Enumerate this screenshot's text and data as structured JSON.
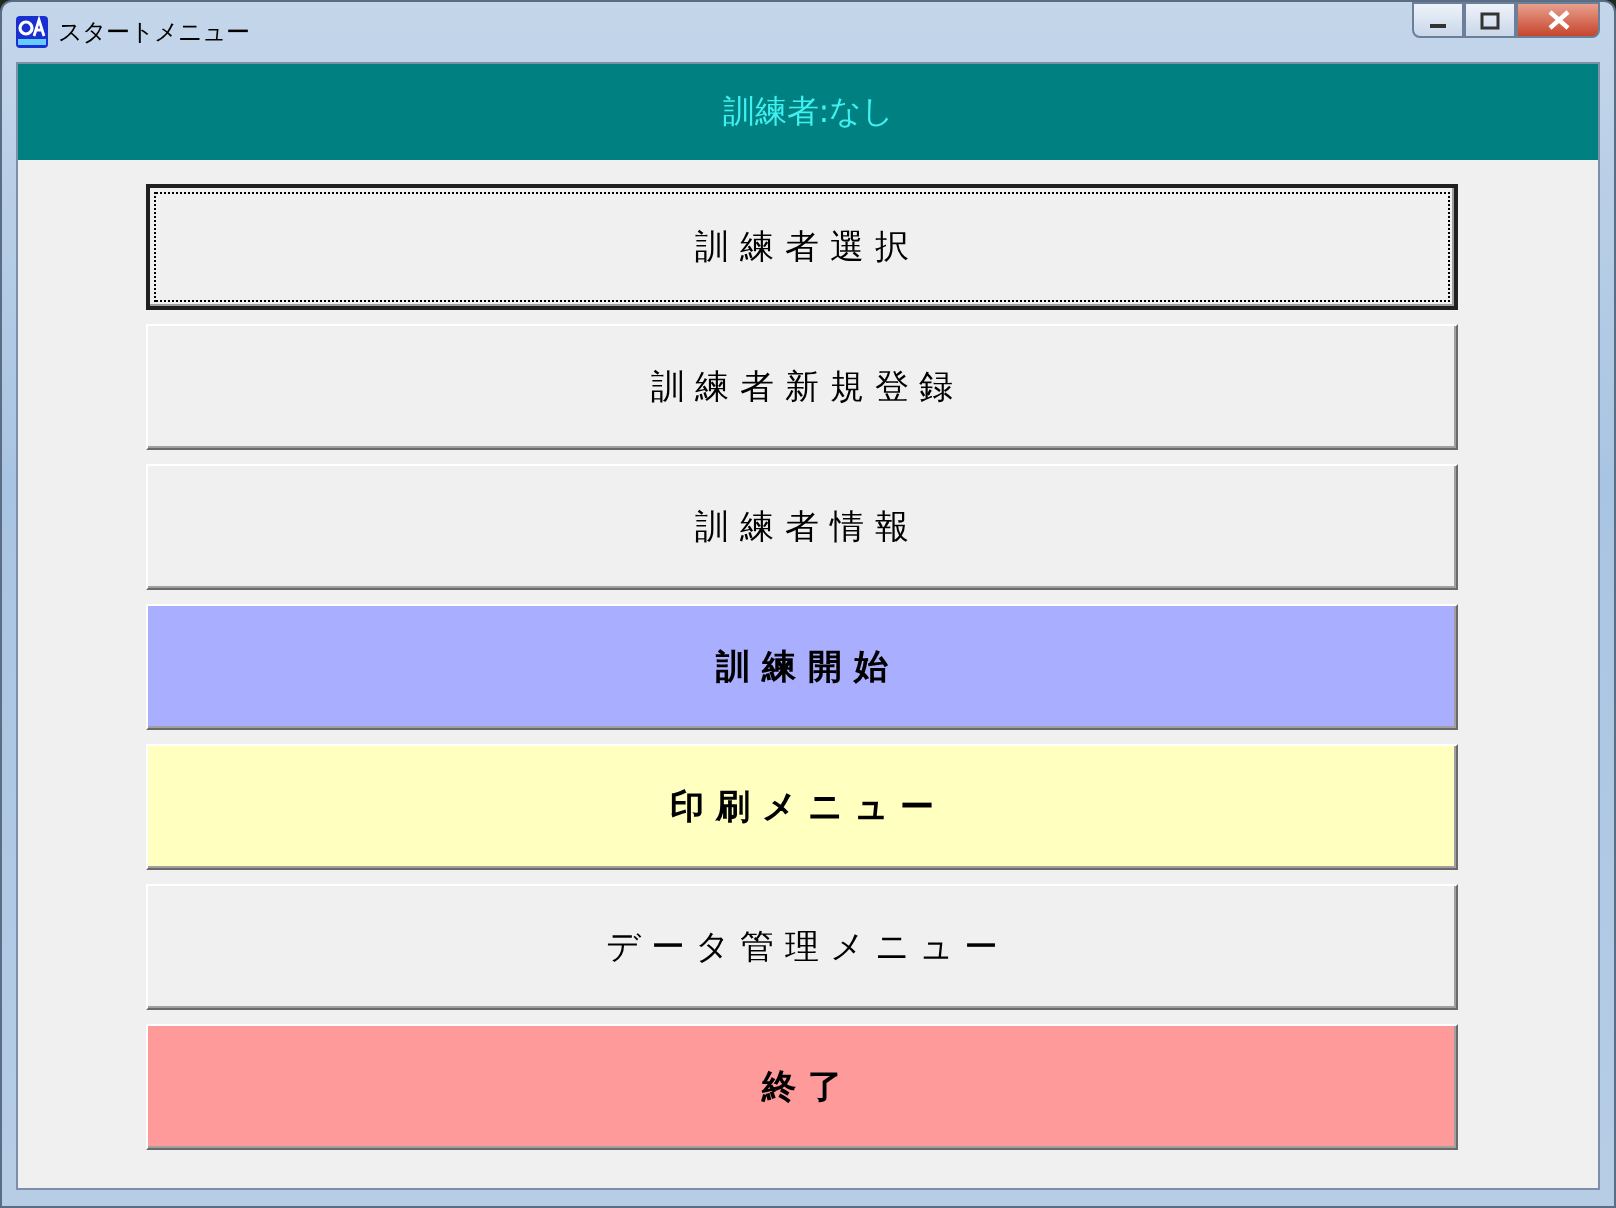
{
  "window": {
    "title": "スタートメニュー"
  },
  "header": {
    "text": "訓練者:なし"
  },
  "buttons": [
    {
      "label": "訓 練 者 選 択",
      "kind": "plain",
      "color": "#f0f0f0",
      "selected": true
    },
    {
      "label": "訓 練 者 新 規 登 録",
      "kind": "plain",
      "color": "#f0f0f0",
      "selected": false
    },
    {
      "label": "訓 練 者 情 報",
      "kind": "plain",
      "color": "#f0f0f0",
      "selected": false
    },
    {
      "label": "訓 練 開 始",
      "kind": "emphasis",
      "color": "#aaaeff",
      "selected": false
    },
    {
      "label": "印 刷 メ ニ ュ ー",
      "kind": "emphasis",
      "color": "#ffffc0",
      "selected": false
    },
    {
      "label": "デ ー タ 管 理 メ ニ ュ ー",
      "kind": "plain",
      "color": "#f0f0f0",
      "selected": false
    },
    {
      "label": "終 了",
      "kind": "emphasis",
      "color": "#ff9a9a",
      "selected": false
    }
  ]
}
